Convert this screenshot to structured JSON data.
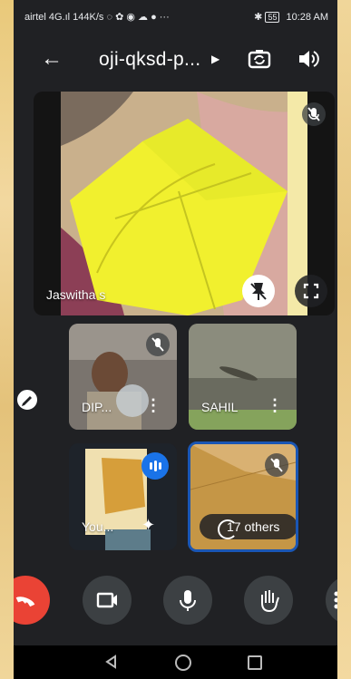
{
  "status_bar": {
    "left": "airtel 4G.ıl 144K/s ◌ ✿ ◉ ☁ ● ···",
    "battery": "55",
    "time": "10:28 AM"
  },
  "app_bar": {
    "title": "oji-qksd-p..."
  },
  "main_tile": {
    "name": "Jaswitha s"
  },
  "tiles": [
    {
      "name": "DIP..."
    },
    {
      "name": "SAHIL"
    },
    {
      "name": "You..."
    },
    {
      "name": "17 others"
    }
  ],
  "colors": {
    "hangup": "#ea4335",
    "accent": "#1a73e8",
    "background": "#202124"
  }
}
